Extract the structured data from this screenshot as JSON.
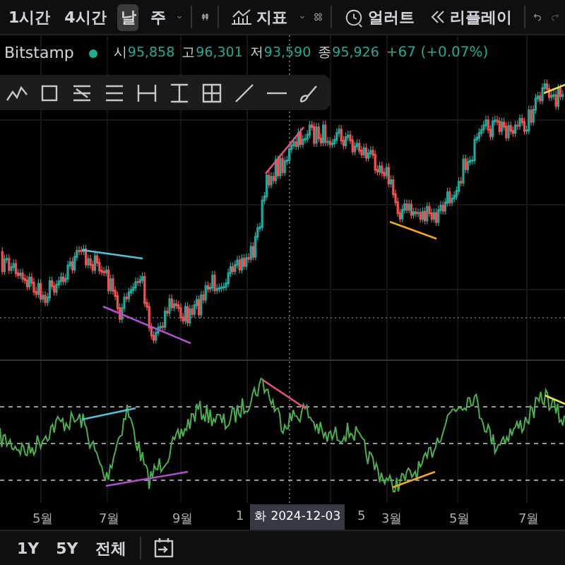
{
  "toolbar": {
    "intervals": [
      {
        "label": "1시간",
        "selected": false
      },
      {
        "label": "4시간",
        "selected": false
      },
      {
        "label": "날",
        "selected": true
      },
      {
        "label": "주",
        "selected": false
      }
    ],
    "indicators_label": "지표",
    "alert_label": "얼러트",
    "replay_label": "리플레이"
  },
  "legend": {
    "exchange": "Bitstamp",
    "values": [
      {
        "label": "시",
        "value": "95,858"
      },
      {
        "label": "고",
        "value": "96,301"
      },
      {
        "label": "저",
        "value": "93,590"
      },
      {
        "label": "종",
        "value": "95,926"
      }
    ],
    "change": "+67 (+0.07%)"
  },
  "time_axis": {
    "labels": [
      "5월",
      "7월",
      "9월",
      "1",
      "5",
      "3월",
      "5월",
      "7월"
    ],
    "crosshair_label": "화 2024-12-03"
  },
  "ranges": [
    "1Y",
    "5Y",
    "전체"
  ]
}
